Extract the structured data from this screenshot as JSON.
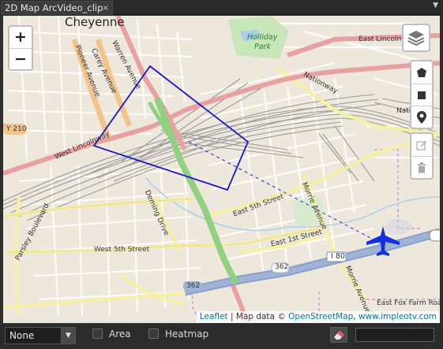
{
  "tab": {
    "title": "2D Map ArcVideo_clip",
    "close": "×",
    "menu": "▼"
  },
  "map": {
    "labels": {
      "city": "Cheyenne",
      "holliday_park": "Holliday Park",
      "east_lincolnway": "East Lincolnway",
      "nationway": "Nationway",
      "natio": "Natio",
      "warren_avenue": "Warren Avenue",
      "carey_avenue": "Carey Avenue",
      "pioneer_avenue": "Pioneer Avenue",
      "west_lincolnway": "West Lincolnway",
      "y210": "Y 210",
      "east_5th_street": "East 5th Street",
      "east_1st_street": "East 1st Street",
      "morrie_avenue_1": "Morrie Avenue",
      "morrie_avenue_2": "Morrie Avenue",
      "parsley_boulevard": "Parsley Boulevard",
      "deming_drive": "Deming Drive",
      "west_5th_street": "West 5th Street",
      "i80": "I 80",
      "r362_a": "362",
      "r362_b": "362",
      "east_fox_farm_road": "East Fox Farm Road"
    },
    "zoom_in": "+",
    "zoom_out": "−",
    "attribution": {
      "leaflet": "Leaflet",
      "sep": " | Map data © ",
      "osm": "OpenStreetMap",
      "comma": ", ",
      "impleo": "www.impleotv.com"
    },
    "colors": {
      "footprint": "#1a16c8",
      "aircraft": "#1330e0",
      "track": "#2b2bd0",
      "background": "#ede7dc",
      "major_road": "#f2c48c",
      "secondary_road": "#f6f0a4",
      "motorway": "#8aa0c8",
      "trunk": "#e8a0a0",
      "park": "#c8e6b8"
    },
    "icons": [
      "layers-icon",
      "polygon-icon",
      "rectangle-icon",
      "marker-icon",
      "edit-icon",
      "delete-icon",
      "aircraft-icon"
    ]
  },
  "toolbar": {
    "mode_select": "None",
    "area_label": "Area",
    "heatmap_label": "Heatmap",
    "area_checked": false,
    "heatmap_checked": false,
    "search_value": ""
  }
}
